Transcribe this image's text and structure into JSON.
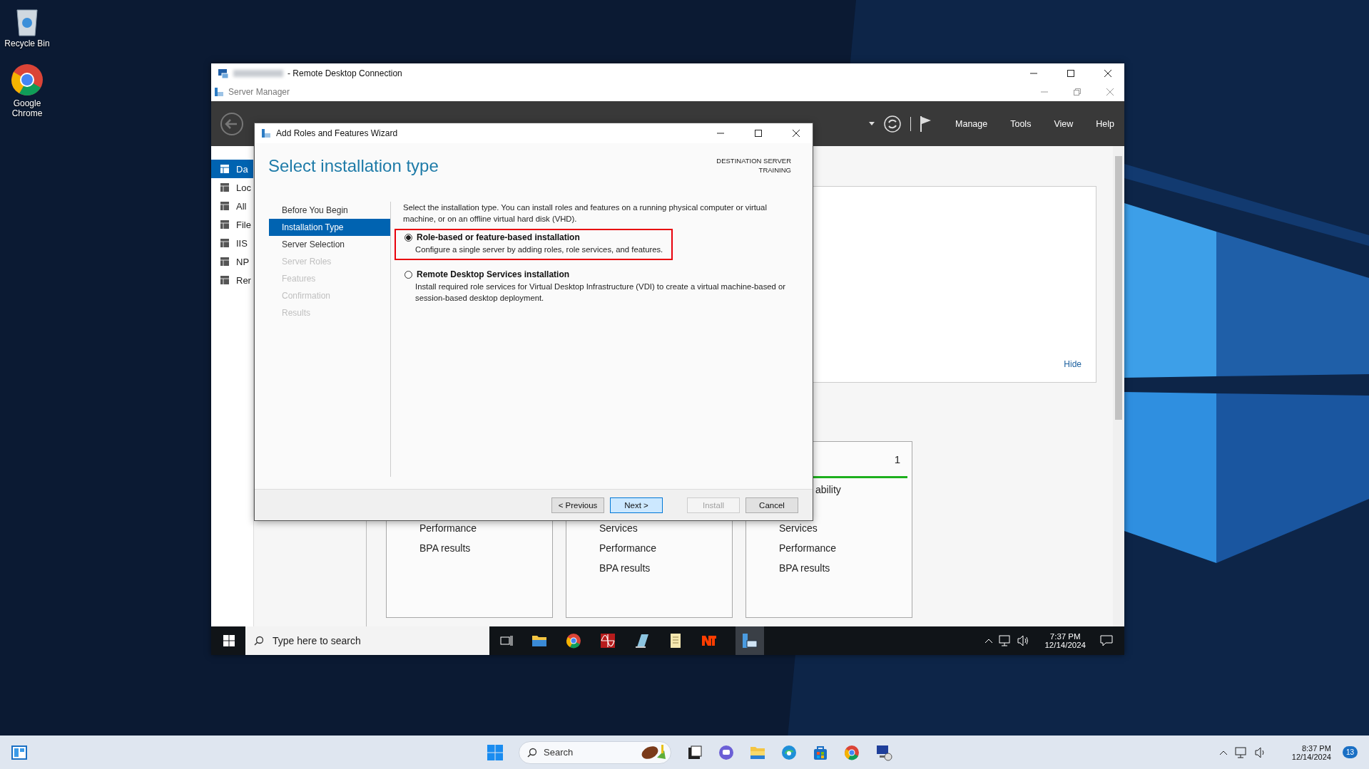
{
  "desktop_icons": [
    {
      "label": "Recycle Bin",
      "kind": "bin"
    },
    {
      "label": "Google Chrome",
      "kind": "browser"
    }
  ],
  "rdp_window": {
    "title": "- Remote Desktop Connection"
  },
  "server_manager": {
    "title": "Server Manager",
    "menu": [
      "Manage",
      "Tools",
      "View",
      "Help"
    ],
    "sidebar": [
      {
        "label": "Da",
        "selected": true
      },
      {
        "label": "Loc",
        "selected": false
      },
      {
        "label": "All",
        "selected": false
      },
      {
        "label": "File",
        "selected": false
      },
      {
        "label": "IIS",
        "selected": false
      },
      {
        "label": "NP",
        "selected": false
      },
      {
        "label": "Rer",
        "selected": false
      }
    ],
    "welcome": {
      "link": "Hide"
    },
    "tiles": [
      {
        "lines": [
          "Performance",
          "BPA results"
        ]
      },
      {
        "lines": [
          "Services",
          "Performance",
          "BPA results"
        ]
      },
      {
        "count": "1",
        "status": "ability",
        "lines": [
          "Services",
          "Performance",
          "BPA results"
        ]
      }
    ]
  },
  "wizard": {
    "title": "Add Roles and Features Wizard",
    "heading": "Select installation type",
    "destination_label": "DESTINATION SERVER",
    "destination_server": "TRAINING",
    "steps": [
      {
        "label": "Before You Begin",
        "selected": false,
        "disabled": false
      },
      {
        "label": "Installation Type",
        "selected": true,
        "disabled": false
      },
      {
        "label": "Server Selection",
        "selected": false,
        "disabled": false
      },
      {
        "label": "Server Roles",
        "selected": false,
        "disabled": true
      },
      {
        "label": "Features",
        "selected": false,
        "disabled": true
      },
      {
        "label": "Confirmation",
        "selected": false,
        "disabled": true
      },
      {
        "label": "Results",
        "selected": false,
        "disabled": true
      }
    ],
    "intro": "Select the installation type. You can install roles and features on a running physical computer or virtual machine, or on an offline virtual hard disk (VHD).",
    "options": [
      {
        "title": "Role-based or feature-based installation",
        "description": "Configure a single server by adding roles, role services, and features.",
        "selected": true,
        "highlighted": true
      },
      {
        "title": "Remote Desktop Services installation",
        "description": "Install required role services for Virtual Desktop Infrastructure (VDI) to create a virtual machine-based or session-based desktop deployment.",
        "selected": false,
        "highlighted": false
      }
    ],
    "buttons": [
      {
        "label": "< Previous",
        "kind": "normal"
      },
      {
        "label": "Next >",
        "kind": "default"
      },
      {
        "label": "Install",
        "kind": "disabled"
      },
      {
        "label": "Cancel",
        "kind": "normal"
      }
    ]
  },
  "remote_taskbar": {
    "search_placeholder": "Type here to search",
    "time": "7:37 PM",
    "date": "12/14/2024"
  },
  "taskbar": {
    "search_placeholder": "Search",
    "time": "8:37 PM",
    "date": "12/14/2024",
    "badge": "13"
  }
}
